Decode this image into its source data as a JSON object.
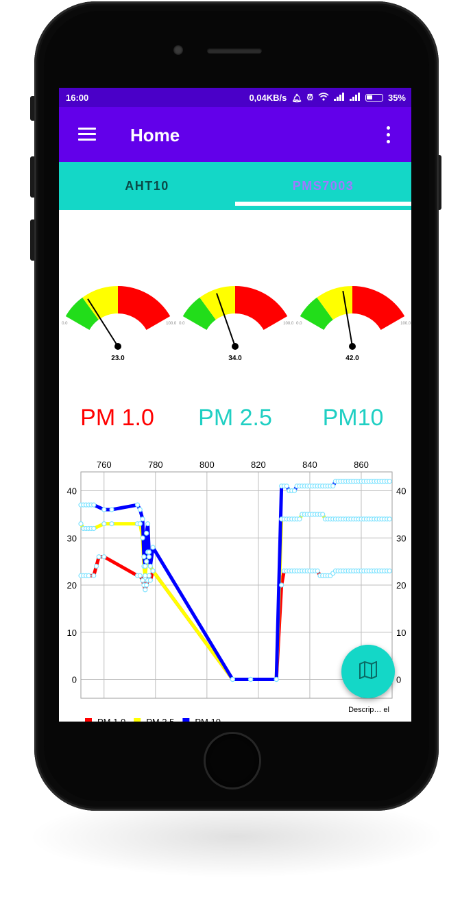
{
  "status_bar": {
    "time": "16:00",
    "network_speed": "0,04KB/s",
    "icons": [
      "mute-icon",
      "alarm-icon",
      "wifi-icon",
      "signal-icon",
      "signal-icon",
      "battery-icon"
    ],
    "battery": "35%"
  },
  "app_bar": {
    "title": "Home",
    "left_icon": "hamburger-menu-icon",
    "right_icon": "more-vertical-icon",
    "color": "#6200ea"
  },
  "tabs": {
    "items": [
      {
        "label": "AHT10",
        "selected": false
      },
      {
        "label": "PMS7003",
        "selected": true
      }
    ],
    "color": "#14d7c7"
  },
  "gauges": [
    {
      "name": "PM 1.0",
      "value": 23.0,
      "value_text": "23.0",
      "min_text": "0.0",
      "max_text": "100.0"
    },
    {
      "name": "PM 2.5",
      "value": 34.0,
      "value_text": "34.0",
      "min_text": "0.0",
      "max_text": "100.0"
    },
    {
      "name": "PM10",
      "value": 42.0,
      "value_text": "42.0",
      "min_text": "0.0",
      "max_text": "100.0"
    }
  ],
  "gauge_bands": [
    {
      "from": 0,
      "to": 20,
      "color": "#22dd1a"
    },
    {
      "from": 20,
      "to": 50,
      "color": "#ffff00"
    },
    {
      "from": 50,
      "to": 100,
      "color": "#ff0000"
    }
  ],
  "pm_labels": [
    {
      "text": "PM 1.0",
      "color": "#ff0000"
    },
    {
      "text": "PM 2.5",
      "color": "#1fcfc3"
    },
    {
      "text": "PM10",
      "color": "#1fcfc3"
    }
  ],
  "chart_data": {
    "type": "line",
    "x_ticks": [
      "760",
      "780",
      "800",
      "820",
      "840",
      "860"
    ],
    "y_ticks": [
      "0",
      "10",
      "20",
      "30",
      "40"
    ],
    "xlim": [
      751,
      872
    ],
    "ylim": [
      -4,
      44
    ],
    "description": "Descrip… el",
    "grid": true,
    "legend_position": "bottom-left",
    "legend": [
      {
        "name": "PM 1.0",
        "color": "#ff0000"
      },
      {
        "name": "PM 2.5",
        "color": "#ffff00"
      },
      {
        "name": "PM 10",
        "color": "#0000ff"
      }
    ],
    "series": [
      {
        "name": "PM 1.0",
        "color": "#ff0000",
        "x": [
          751,
          752,
          753,
          754,
          756,
          757,
          758,
          760,
          773,
          774,
          775,
          775.5,
          776,
          776.5,
          777,
          777.5,
          778,
          779,
          810,
          817,
          827,
          829,
          830,
          831,
          832,
          833,
          834,
          835,
          836,
          837,
          838,
          839,
          840,
          841,
          842,
          843,
          844,
          845,
          846,
          847,
          848,
          849,
          850,
          851,
          852,
          853,
          854,
          855,
          856,
          857,
          858,
          859,
          860,
          861,
          862,
          863,
          864,
          865,
          866,
          867,
          868,
          869,
          870,
          871
        ],
        "values": [
          22,
          22,
          22,
          22,
          22,
          24,
          26,
          26,
          22,
          22,
          21,
          20,
          19,
          20,
          21,
          22,
          21,
          23,
          0,
          0,
          0,
          20,
          23,
          23,
          23,
          23,
          23,
          23,
          23,
          23,
          23,
          23,
          23,
          23,
          23,
          23,
          22,
          22,
          22,
          22,
          22,
          22.5,
          23,
          23,
          23,
          23,
          23,
          23,
          23,
          23,
          23,
          23,
          23,
          23,
          23,
          23,
          23,
          23,
          23,
          23,
          23,
          23,
          23,
          23
        ]
      },
      {
        "name": "PM 2.5",
        "color": "#ffff00",
        "x": [
          751,
          752,
          753,
          754,
          755,
          756,
          760,
          763,
          773,
          774,
          775,
          775.5,
          776,
          776.5,
          777,
          777.5,
          778,
          779,
          810,
          817,
          827,
          829,
          830,
          831,
          832,
          833,
          834,
          835,
          836,
          837,
          838,
          839,
          840,
          841,
          842,
          843,
          844,
          845,
          846,
          847,
          848,
          849,
          850,
          851,
          852,
          853,
          854,
          855,
          856,
          857,
          858,
          859,
          860,
          861,
          862,
          863,
          864,
          865,
          866,
          867,
          868,
          869,
          870,
          871
        ],
        "values": [
          33,
          32,
          32,
          32,
          32,
          32,
          33,
          33,
          33,
          33,
          30,
          24,
          22,
          25,
          27,
          26,
          24,
          23,
          0,
          0,
          0,
          34,
          34,
          34,
          34,
          34,
          34,
          34,
          34,
          35,
          35,
          35,
          35,
          35,
          35,
          35,
          35,
          35,
          34,
          34,
          34,
          34,
          34,
          34,
          34,
          34,
          34,
          34,
          34,
          34,
          34,
          34,
          34,
          34,
          34,
          34,
          34,
          34,
          34,
          34,
          34,
          34,
          34,
          34
        ]
      },
      {
        "name": "PM 10",
        "color": "#0000ff",
        "x": [
          751,
          752,
          753,
          754,
          755,
          756,
          760,
          763,
          773,
          774,
          775,
          775.5,
          776,
          776.5,
          777,
          777.5,
          778,
          779,
          810,
          817,
          827,
          829,
          830,
          831,
          832,
          833,
          834,
          835,
          836,
          837,
          838,
          839,
          840,
          841,
          842,
          843,
          844,
          845,
          846,
          847,
          848,
          849,
          850,
          851,
          852,
          853,
          854,
          855,
          856,
          857,
          858,
          859,
          860,
          861,
          862,
          863,
          864,
          865,
          866,
          867,
          868,
          869,
          870,
          871
        ],
        "values": [
          37,
          37,
          37,
          37,
          37,
          37,
          36,
          36,
          37,
          36,
          34,
          26,
          24,
          31,
          33,
          27,
          24,
          28,
          0,
          0,
          0,
          41,
          41,
          41,
          40,
          40,
          40,
          41,
          41,
          41,
          41,
          41,
          41,
          41,
          41,
          41,
          41,
          41,
          41,
          41,
          41,
          41,
          42,
          42,
          42,
          42,
          42,
          42,
          42,
          42,
          42,
          42,
          42,
          42,
          42,
          42,
          42,
          42,
          42,
          42,
          42,
          42,
          42,
          42
        ]
      }
    ]
  },
  "fab": {
    "icon": "map-icon",
    "color": "#14d7c7"
  }
}
